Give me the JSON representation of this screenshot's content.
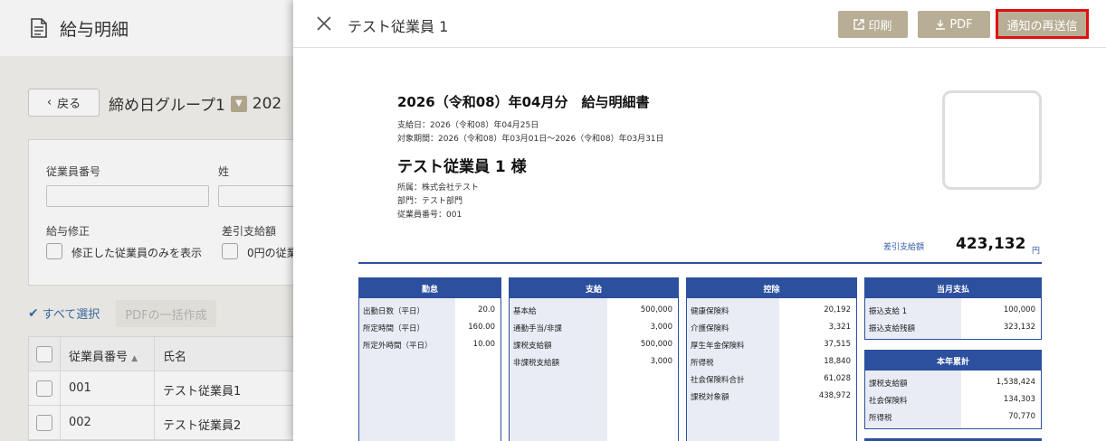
{
  "background": {
    "app_title": "給与明細",
    "back_label": "戻る",
    "group_name": "締め日グループ1",
    "group_suffix": "202",
    "filter": {
      "employee_number_label": "従業員番号",
      "last_name_label": "姓",
      "salary_fix_label": "給与修正",
      "salary_fix_option": "修正した従業員のみを表示",
      "net_pay_label": "差引支給額",
      "net_pay_option": "0円の従業"
    },
    "select_all": "すべて選択",
    "pdf_bulk": "PDFの一括作成",
    "table": {
      "col_number": "従業員番号",
      "col_name": "氏名",
      "rows": [
        {
          "number": "001",
          "name": "テスト従業員1"
        },
        {
          "number": "002",
          "name": "テスト従業員2"
        }
      ]
    }
  },
  "panel": {
    "title": "テスト従業員 1",
    "print_label": "印刷",
    "pdf_label": "PDF",
    "resend_label": "通知の再送信"
  },
  "payslip": {
    "title": "2026（令和08）年04月分　給与明細書",
    "pay_date": "支給日：2026（令和08）年04月25日",
    "period": "対象期間：2026（令和08）年03月01日～2026（令和08）年03月31日",
    "employee_name": "テスト従業員 1 様",
    "affiliation": "所属：株式会社テスト",
    "department": "部門：テスト部門",
    "employee_number": "従業員番号：001",
    "net_pay_label": "差引支給額",
    "net_pay_value": "423,132",
    "net_pay_unit": "円",
    "attendance": {
      "header": "勤怠",
      "rows": [
        {
          "k": "出勤日数（平日）",
          "v": "20.0"
        },
        {
          "k": "所定時間（平日）",
          "v": "160.00"
        },
        {
          "k": "所定外時間（平日）",
          "v": "10.00"
        }
      ]
    },
    "payments": {
      "header": "支給",
      "rows": [
        {
          "k": "基本給",
          "v": "500,000"
        },
        {
          "k": "通勤手当/非課",
          "v": "3,000"
        },
        {
          "k": "課税支給額",
          "v": "500,000"
        },
        {
          "k": "非課税支給額",
          "v": "3,000"
        }
      ]
    },
    "deductions": {
      "header": "控除",
      "rows": [
        {
          "k": "健康保険料",
          "v": "20,192"
        },
        {
          "k": "介護保険料",
          "v": "3,321"
        },
        {
          "k": "厚生年金保険料",
          "v": "37,515"
        },
        {
          "k": "所得税",
          "v": "18,840"
        },
        {
          "k": "社会保険料合計",
          "v": "61,028"
        },
        {
          "k": "課税対象額",
          "v": "438,972"
        }
      ]
    },
    "monthly": {
      "header": "当月支払",
      "rows": [
        {
          "k": "振込支給 1",
          "v": "100,000"
        },
        {
          "k": "振込支給残額",
          "v": "323,132"
        }
      ]
    },
    "ytd": {
      "header": "本年累計",
      "rows": [
        {
          "k": "課税支給額",
          "v": "1,538,424"
        },
        {
          "k": "社会保険料",
          "v": "134,303"
        },
        {
          "k": "所得税",
          "v": "70,770"
        }
      ]
    }
  }
}
